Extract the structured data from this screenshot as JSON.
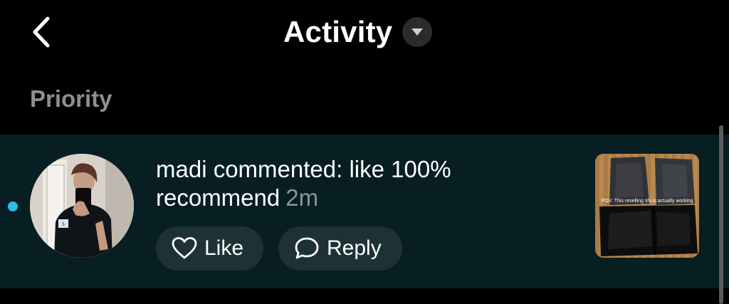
{
  "header": {
    "title": "Activity",
    "back_icon": "chevron-left-icon",
    "dropdown_icon": "caret-down-icon"
  },
  "section": {
    "title": "Priority"
  },
  "notification": {
    "text": "madi commented: like 100% recommend",
    "time": "2m",
    "unread": true,
    "avatar_icon": "user-avatar",
    "thumbnail_caption": "POV: This reselling shi is actually working",
    "actions": {
      "like_label": "Like",
      "like_icon": "heart-icon",
      "reply_label": "Reply",
      "reply_icon": "comment-bubble-icon"
    }
  },
  "colors": {
    "background": "#000000",
    "row_background": "#071e22",
    "pill_background": "#1e3236",
    "unread_dot": "#2dbde8",
    "muted_text": "#8e8e8e"
  }
}
